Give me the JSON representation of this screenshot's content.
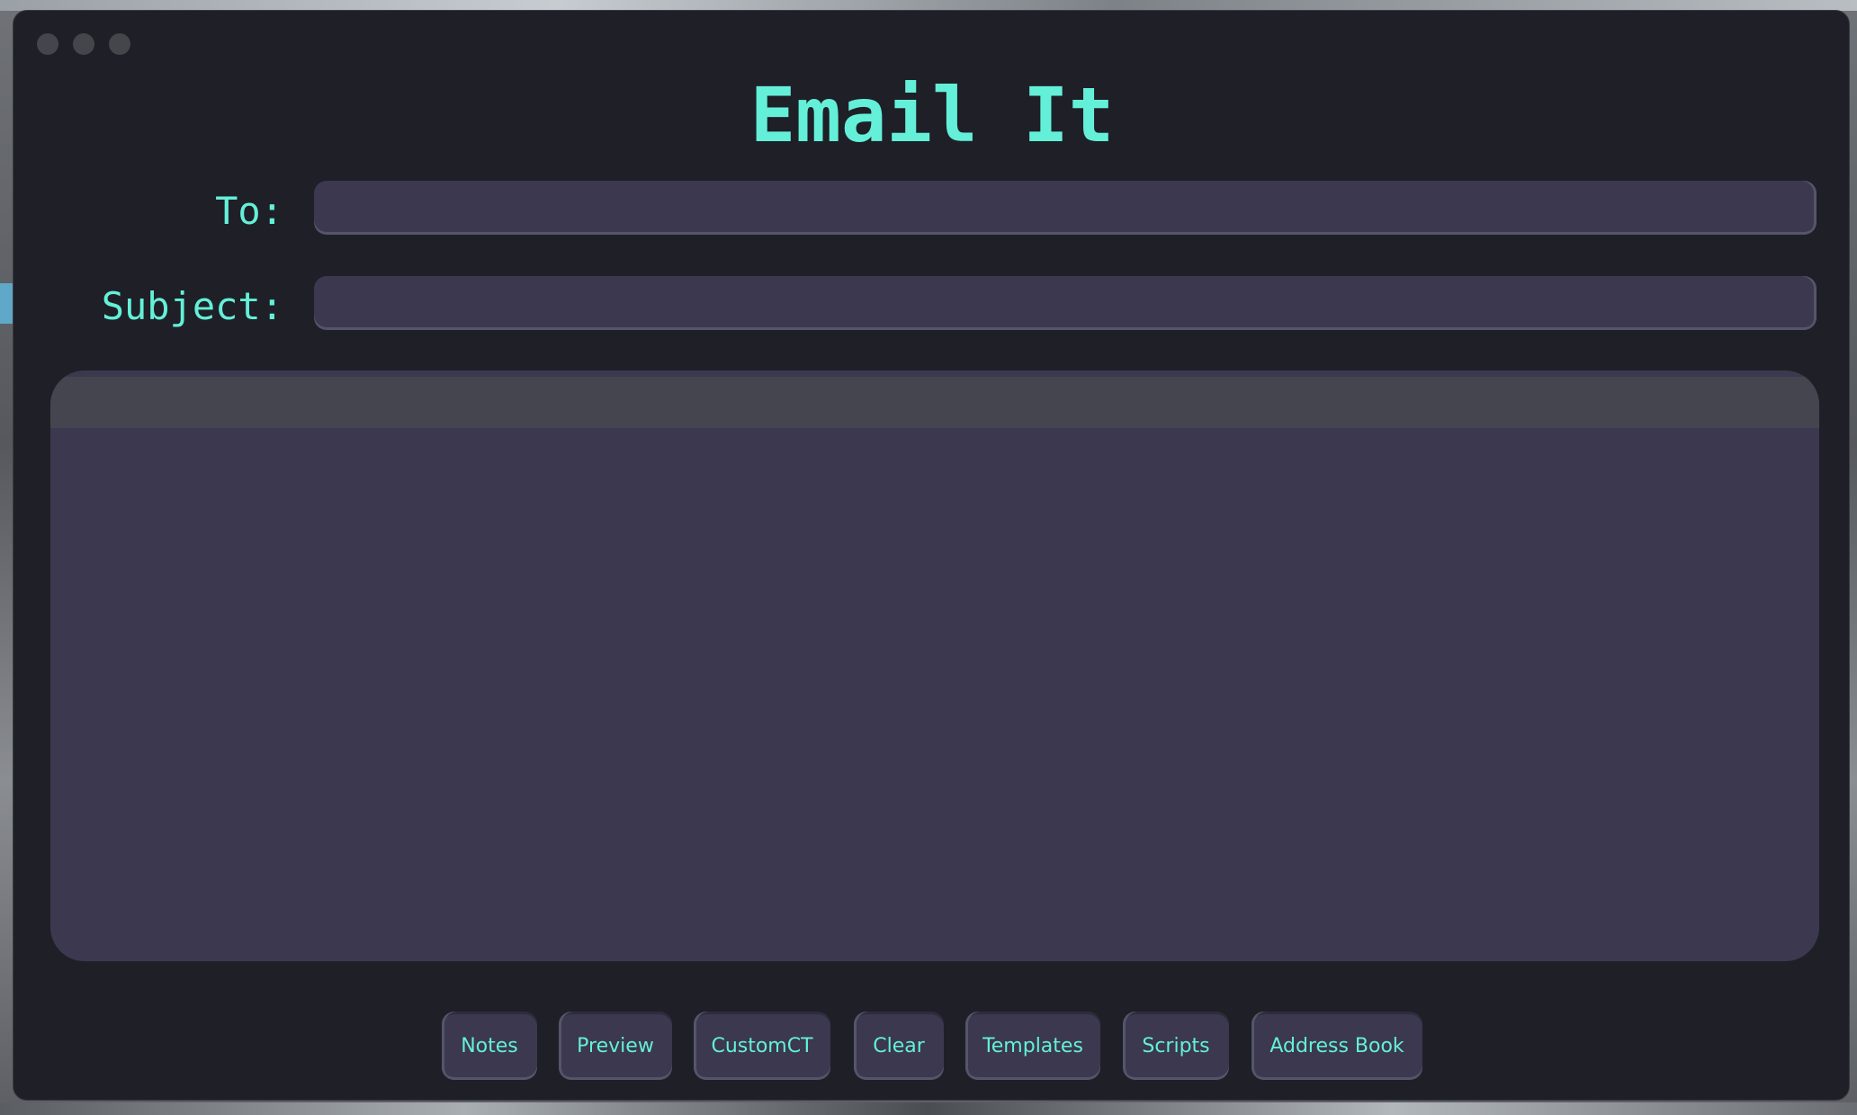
{
  "app": {
    "title": "Email It"
  },
  "form": {
    "to_label": "To:",
    "to_value": "",
    "subject_label": "Subject:",
    "subject_value": ""
  },
  "editor": {
    "body_text": ""
  },
  "buttons": [
    {
      "label": "Notes"
    },
    {
      "label": "Preview"
    },
    {
      "label": "CustomCT"
    },
    {
      "label": "Clear"
    },
    {
      "label": "Templates"
    },
    {
      "label": "Scripts"
    },
    {
      "label": "Address Book"
    }
  ],
  "colors": {
    "accent": "#64f0d8",
    "window_bg": "#1f1f27",
    "field_bg": "#3b384f",
    "toolbar_bg": "#45454f"
  }
}
